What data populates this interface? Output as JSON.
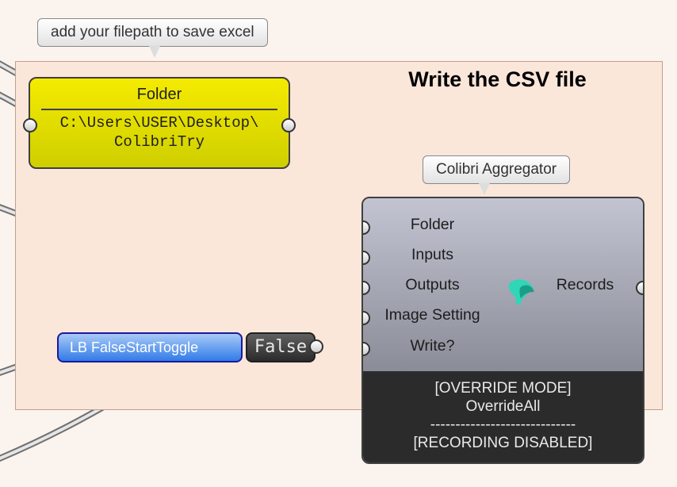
{
  "group_title": "Write the CSV file",
  "tooltips": {
    "filepath": "add your filepath to save excel",
    "aggregator": "Colibri Aggregator"
  },
  "folder": {
    "title": "Folder",
    "path_line1": "C:\\Users\\USER\\Desktop\\",
    "path_line2": "ColibriTry"
  },
  "toggle": {
    "label": "LB FalseStartToggle",
    "value": "False"
  },
  "aggregator": {
    "inputs": {
      "folder": "Folder",
      "inputs": "Inputs",
      "outputs": "Outputs",
      "image_setting": "Image Setting",
      "write": "Write?"
    },
    "outputs": {
      "records": "Records"
    },
    "status": {
      "override_mode": "[OVERRIDE MODE]",
      "override_value": "OverrideAll",
      "dashes": "-----------------------------",
      "recording": "[RECORDING DISABLED]"
    },
    "icon_name": "colibri-icon"
  }
}
